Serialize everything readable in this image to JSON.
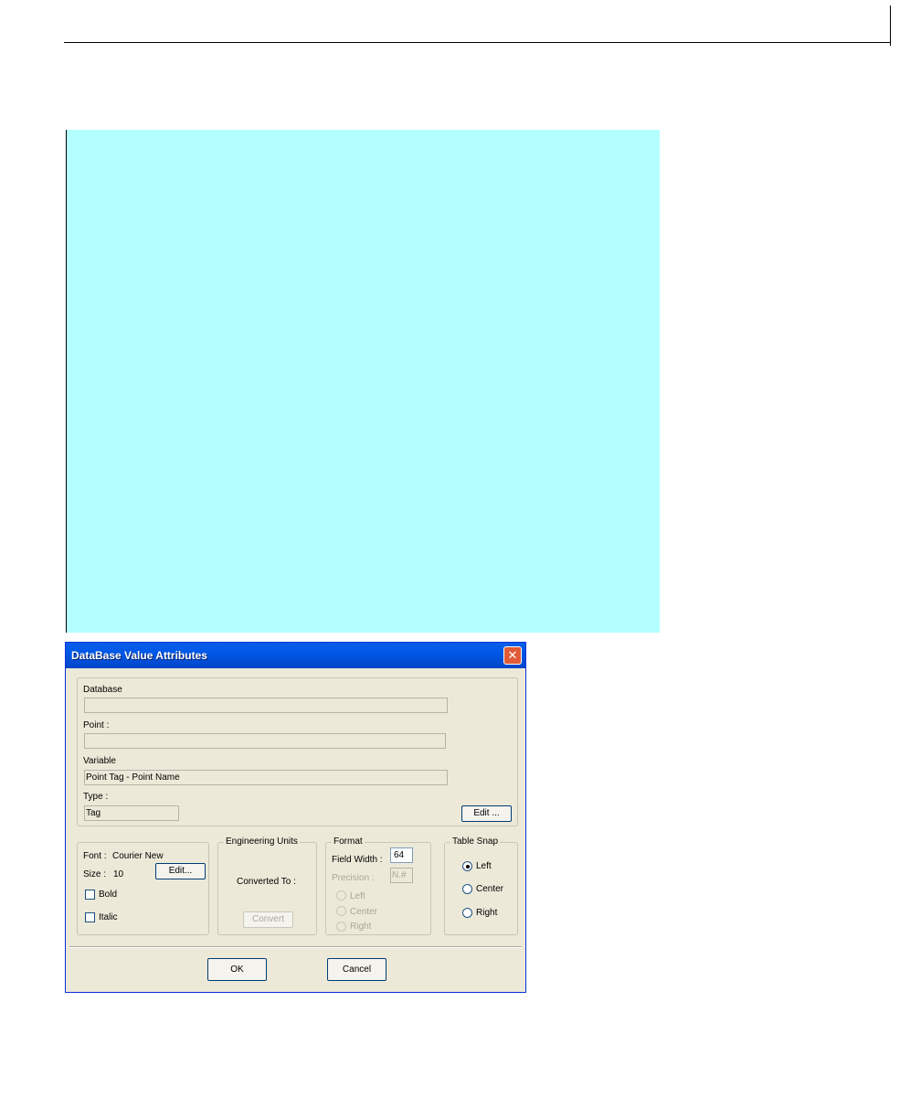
{
  "dialog": {
    "title": "DataBase Value Attributes",
    "close_glyph": "✕",
    "top_group": {
      "database_label": "Database",
      "database_value": "",
      "point_label": "Point :",
      "point_value": "",
      "variable_label": "Variable",
      "variable_value": "Point Tag - Point Name",
      "type_label": "Type :",
      "type_value": "Tag",
      "edit_button": "Edit ..."
    },
    "font_group": {
      "font_label": "Font :",
      "font_value": "Courier New",
      "size_label": "Size :",
      "size_value": "10",
      "edit_button": "Edit...",
      "bold_label": "Bold",
      "bold_checked": false,
      "italic_label": "Italic",
      "italic_checked": false
    },
    "eng_units": {
      "legend": "Engineering Units",
      "converted_to_label": "Converted To :",
      "convert_button": "Convert"
    },
    "format": {
      "legend": "Format",
      "field_width_label": "Field Width :",
      "field_width_value": "64",
      "precision_label": "Precision :",
      "precision_value": "N.#",
      "left_label": "Left",
      "center_label": "Center",
      "right_label": "Right"
    },
    "table_snap": {
      "legend": "Table Snap",
      "left_label": "Left",
      "center_label": "Center",
      "right_label": "Right",
      "selected": "Left"
    },
    "ok_button": "OK",
    "cancel_button": "Cancel"
  },
  "colors": {
    "panel_bg": "#b3ffff",
    "dialog_bg": "#ece9d8",
    "titlebar": "#0058e6",
    "close_button": "#e05b36"
  }
}
